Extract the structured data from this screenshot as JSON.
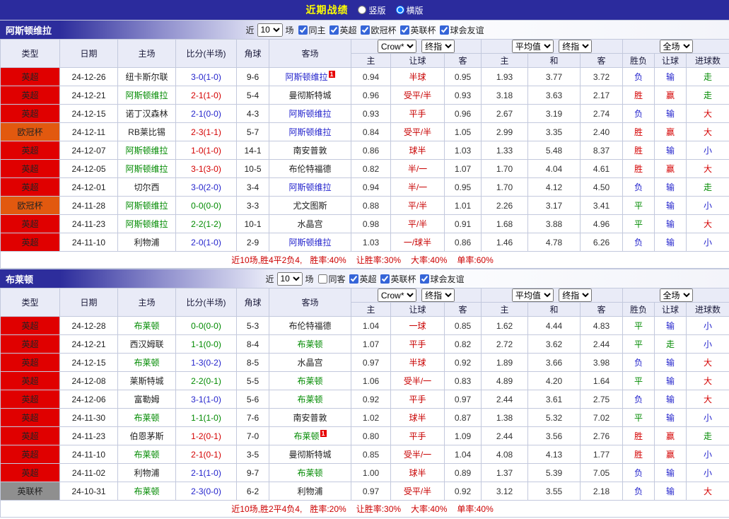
{
  "palette": {
    "red": "#d40000",
    "blue": "#2323cc",
    "green": "#008a00",
    "black": "#222222",
    "odds": "#333333",
    "handicap_red": "#c80000",
    "league_epl": "#e00000",
    "league_ucl": "#e2590f",
    "league_efl": "#8f8f8f",
    "topbar_bg": "#2b2b9d",
    "title_yellow": "#ffff00",
    "header_bg": "#e9ebf7",
    "summary_red": "#cc0000"
  },
  "top_bar": {
    "title": "近期战绩",
    "radio_vertical": "竖版",
    "radio_horizontal": "横版"
  },
  "sections": [
    {
      "team": "阿斯顿维拉",
      "controls": {
        "near_label": "近",
        "count": "10",
        "games_label": "场",
        "same": {
          "label": "同主",
          "checked": true
        },
        "filters": [
          {
            "label": "英超",
            "checked": true
          },
          {
            "label": "欧冠杯",
            "checked": true
          },
          {
            "label": "英联杯",
            "checked": true
          },
          {
            "label": "球会友谊",
            "checked": true
          }
        ]
      },
      "header": {
        "type": "类型",
        "date": "日期",
        "home": "主场",
        "score": "比分(半场)",
        "corner": "角球",
        "away": "客场",
        "asia_select1": "Crow*",
        "asia_select2": "终指",
        "asia_home": "主",
        "asia_handicap": "让球",
        "asia_away": "客",
        "euro_select1": "平均值",
        "euro_select2": "终指",
        "euro_home": "主",
        "euro_draw": "和",
        "euro_away": "客",
        "full_select": "全场",
        "result": "胜负",
        "handicap_result": "让球",
        "goals": "进球数"
      },
      "rows": [
        {
          "league": "英超",
          "league_key": "epl",
          "date": "24-12-26",
          "home": "纽卡斯尔联",
          "home_color": "black",
          "score": "3-0(1-0)",
          "score_color": "blue",
          "corner": "9-6",
          "away": "阿斯顿维拉",
          "away_color": "blue",
          "away_badge": "1",
          "asia": [
            "0.94",
            "半球",
            "0.95"
          ],
          "euro": [
            "1.93",
            "3.77",
            "3.72"
          ],
          "results": [
            "负",
            "输",
            "走"
          ],
          "result_colors": [
            "blue",
            "blue",
            "green"
          ]
        },
        {
          "league": "英超",
          "league_key": "epl",
          "date": "24-12-21",
          "home": "阿斯顿维拉",
          "home_color": "green",
          "score": "2-1(1-0)",
          "score_color": "red",
          "corner": "5-4",
          "away": "曼彻斯特城",
          "away_color": "black",
          "away_badge": "",
          "asia": [
            "0.96",
            "受平/半",
            "0.93"
          ],
          "euro": [
            "3.18",
            "3.63",
            "2.17"
          ],
          "results": [
            "胜",
            "赢",
            "走"
          ],
          "result_colors": [
            "red",
            "red",
            "green"
          ]
        },
        {
          "league": "英超",
          "league_key": "epl",
          "date": "24-12-15",
          "home": "诺丁汉森林",
          "home_color": "black",
          "score": "2-1(0-0)",
          "score_color": "blue",
          "corner": "4-3",
          "away": "阿斯顿维拉",
          "away_color": "blue",
          "away_badge": "",
          "asia": [
            "0.93",
            "平手",
            "0.96"
          ],
          "euro": [
            "2.67",
            "3.19",
            "2.74"
          ],
          "results": [
            "负",
            "输",
            "大"
          ],
          "result_colors": [
            "blue",
            "blue",
            "red"
          ]
        },
        {
          "league": "欧冠杯",
          "league_key": "ucl",
          "date": "24-12-11",
          "home": "RB莱比锡",
          "home_color": "black",
          "score": "2-3(1-1)",
          "score_color": "red",
          "corner": "5-7",
          "away": "阿斯顿维拉",
          "away_color": "blue",
          "away_badge": "",
          "asia": [
            "0.84",
            "受平/半",
            "1.05"
          ],
          "euro": [
            "2.99",
            "3.35",
            "2.40"
          ],
          "results": [
            "胜",
            "赢",
            "大"
          ],
          "result_colors": [
            "red",
            "red",
            "red"
          ]
        },
        {
          "league": "英超",
          "league_key": "epl",
          "date": "24-12-07",
          "home": "阿斯顿维拉",
          "home_color": "green",
          "score": "1-0(1-0)",
          "score_color": "red",
          "corner": "14-1",
          "away": "南安普敦",
          "away_color": "black",
          "away_badge": "",
          "asia": [
            "0.86",
            "球半",
            "1.03"
          ],
          "euro": [
            "1.33",
            "5.48",
            "8.37"
          ],
          "results": [
            "胜",
            "输",
            "小"
          ],
          "result_colors": [
            "red",
            "blue",
            "blue"
          ]
        },
        {
          "league": "英超",
          "league_key": "epl",
          "date": "24-12-05",
          "home": "阿斯顿维拉",
          "home_color": "green",
          "score": "3-1(3-0)",
          "score_color": "red",
          "corner": "10-5",
          "away": "布伦特福德",
          "away_color": "black",
          "away_badge": "",
          "asia": [
            "0.82",
            "半/一",
            "1.07"
          ],
          "euro": [
            "1.70",
            "4.04",
            "4.61"
          ],
          "results": [
            "胜",
            "赢",
            "大"
          ],
          "result_colors": [
            "red",
            "red",
            "red"
          ]
        },
        {
          "league": "英超",
          "league_key": "epl",
          "date": "24-12-01",
          "home": "切尔西",
          "home_color": "black",
          "score": "3-0(2-0)",
          "score_color": "blue",
          "corner": "3-4",
          "away": "阿斯顿维拉",
          "away_color": "blue",
          "away_badge": "",
          "asia": [
            "0.94",
            "半/一",
            "0.95"
          ],
          "euro": [
            "1.70",
            "4.12",
            "4.50"
          ],
          "results": [
            "负",
            "输",
            "走"
          ],
          "result_colors": [
            "blue",
            "blue",
            "green"
          ]
        },
        {
          "league": "欧冠杯",
          "league_key": "ucl",
          "date": "24-11-28",
          "home": "阿斯顿维拉",
          "home_color": "green",
          "score": "0-0(0-0)",
          "score_color": "green",
          "corner": "3-3",
          "away": "尤文图斯",
          "away_color": "black",
          "away_badge": "",
          "asia": [
            "0.88",
            "平/半",
            "1.01"
          ],
          "euro": [
            "2.26",
            "3.17",
            "3.41"
          ],
          "results": [
            "平",
            "输",
            "小"
          ],
          "result_colors": [
            "green",
            "blue",
            "blue"
          ]
        },
        {
          "league": "英超",
          "league_key": "epl",
          "date": "24-11-23",
          "home": "阿斯顿维拉",
          "home_color": "green",
          "score": "2-2(1-2)",
          "score_color": "green",
          "corner": "10-1",
          "away": "水晶宫",
          "away_color": "black",
          "away_badge": "",
          "asia": [
            "0.98",
            "平/半",
            "0.91"
          ],
          "euro": [
            "1.68",
            "3.88",
            "4.96"
          ],
          "results": [
            "平",
            "输",
            "大"
          ],
          "result_colors": [
            "green",
            "blue",
            "red"
          ]
        },
        {
          "league": "英超",
          "league_key": "epl",
          "date": "24-11-10",
          "home": "利物浦",
          "home_color": "black",
          "score": "2-0(1-0)",
          "score_color": "blue",
          "corner": "2-9",
          "away": "阿斯顿维拉",
          "away_color": "blue",
          "away_badge": "",
          "asia": [
            "1.03",
            "一/球半",
            "0.86"
          ],
          "euro": [
            "1.46",
            "4.78",
            "6.26"
          ],
          "results": [
            "负",
            "输",
            "小"
          ],
          "result_colors": [
            "blue",
            "blue",
            "blue"
          ]
        }
      ],
      "summary": {
        "prefix": "近10场,胜4平2负4,",
        "rates": [
          "胜率:40%",
          "让胜率:30%",
          "大率:40%",
          "单率:60%"
        ]
      }
    },
    {
      "team": "布莱顿",
      "controls": {
        "near_label": "近",
        "count": "10",
        "games_label": "场",
        "same": {
          "label": "同客",
          "checked": false
        },
        "filters": [
          {
            "label": "英超",
            "checked": true
          },
          {
            "label": "英联杯",
            "checked": true
          },
          {
            "label": "球会友谊",
            "checked": true
          }
        ]
      },
      "header": {
        "type": "类型",
        "date": "日期",
        "home": "主场",
        "score": "比分(半场)",
        "corner": "角球",
        "away": "客场",
        "asia_select1": "Crow*",
        "asia_select2": "终指",
        "asia_home": "主",
        "asia_handicap": "让球",
        "asia_away": "客",
        "euro_select1": "平均值",
        "euro_select2": "终指",
        "euro_home": "主",
        "euro_draw": "和",
        "euro_away": "客",
        "full_select": "全场",
        "result": "胜负",
        "handicap_result": "让球",
        "goals": "进球数"
      },
      "rows": [
        {
          "league": "英超",
          "league_key": "epl",
          "date": "24-12-28",
          "home": "布莱顿",
          "home_color": "green",
          "score": "0-0(0-0)",
          "score_color": "green",
          "corner": "5-3",
          "away": "布伦特福德",
          "away_color": "black",
          "away_badge": "",
          "asia": [
            "1.04",
            "一球",
            "0.85"
          ],
          "euro": [
            "1.62",
            "4.44",
            "4.83"
          ],
          "results": [
            "平",
            "输",
            "小"
          ],
          "result_colors": [
            "green",
            "blue",
            "blue"
          ]
        },
        {
          "league": "英超",
          "league_key": "epl",
          "date": "24-12-21",
          "home": "西汉姆联",
          "home_color": "black",
          "score": "1-1(0-0)",
          "score_color": "green",
          "corner": "8-4",
          "away": "布莱顿",
          "away_color": "green",
          "away_badge": "",
          "asia": [
            "1.07",
            "平手",
            "0.82"
          ],
          "euro": [
            "2.72",
            "3.62",
            "2.44"
          ],
          "results": [
            "平",
            "走",
            "小"
          ],
          "result_colors": [
            "green",
            "green",
            "blue"
          ]
        },
        {
          "league": "英超",
          "league_key": "epl",
          "date": "24-12-15",
          "home": "布莱顿",
          "home_color": "green",
          "score": "1-3(0-2)",
          "score_color": "blue",
          "corner": "8-5",
          "away": "水晶宫",
          "away_color": "black",
          "away_badge": "",
          "asia": [
            "0.97",
            "半球",
            "0.92"
          ],
          "euro": [
            "1.89",
            "3.66",
            "3.98"
          ],
          "results": [
            "负",
            "输",
            "大"
          ],
          "result_colors": [
            "blue",
            "blue",
            "red"
          ]
        },
        {
          "league": "英超",
          "league_key": "epl",
          "date": "24-12-08",
          "home": "莱斯特城",
          "home_color": "black",
          "score": "2-2(0-1)",
          "score_color": "green",
          "corner": "5-5",
          "away": "布莱顿",
          "away_color": "green",
          "away_badge": "",
          "asia": [
            "1.06",
            "受半/一",
            "0.83"
          ],
          "euro": [
            "4.89",
            "4.20",
            "1.64"
          ],
          "results": [
            "平",
            "输",
            "大"
          ],
          "result_colors": [
            "green",
            "blue",
            "red"
          ]
        },
        {
          "league": "英超",
          "league_key": "epl",
          "date": "24-12-06",
          "home": "富勒姆",
          "home_color": "black",
          "score": "3-1(1-0)",
          "score_color": "blue",
          "corner": "5-6",
          "away": "布莱顿",
          "away_color": "green",
          "away_badge": "",
          "asia": [
            "0.92",
            "平手",
            "0.97"
          ],
          "euro": [
            "2.44",
            "3.61",
            "2.75"
          ],
          "results": [
            "负",
            "输",
            "大"
          ],
          "result_colors": [
            "blue",
            "blue",
            "red"
          ]
        },
        {
          "league": "英超",
          "league_key": "epl",
          "date": "24-11-30",
          "home": "布莱顿",
          "home_color": "green",
          "score": "1-1(1-0)",
          "score_color": "green",
          "corner": "7-6",
          "away": "南安普敦",
          "away_color": "black",
          "away_badge": "",
          "asia": [
            "1.02",
            "球半",
            "0.87"
          ],
          "euro": [
            "1.38",
            "5.32",
            "7.02"
          ],
          "results": [
            "平",
            "输",
            "小"
          ],
          "result_colors": [
            "green",
            "blue",
            "blue"
          ]
        },
        {
          "league": "英超",
          "league_key": "epl",
          "date": "24-11-23",
          "home": "伯恩茅斯",
          "home_color": "black",
          "score": "1-2(0-1)",
          "score_color": "red",
          "corner": "7-0",
          "away": "布莱顿",
          "away_color": "green",
          "away_badge": "1",
          "asia": [
            "0.80",
            "平手",
            "1.09"
          ],
          "euro": [
            "2.44",
            "3.56",
            "2.76"
          ],
          "results": [
            "胜",
            "赢",
            "走"
          ],
          "result_colors": [
            "red",
            "red",
            "green"
          ]
        },
        {
          "league": "英超",
          "league_key": "epl",
          "date": "24-11-10",
          "home": "布莱顿",
          "home_color": "green",
          "score": "2-1(0-1)",
          "score_color": "red",
          "corner": "3-5",
          "away": "曼彻斯特城",
          "away_color": "black",
          "away_badge": "",
          "asia": [
            "0.85",
            "受半/一",
            "1.04"
          ],
          "euro": [
            "4.08",
            "4.13",
            "1.77"
          ],
          "results": [
            "胜",
            "赢",
            "小"
          ],
          "result_colors": [
            "red",
            "red",
            "blue"
          ]
        },
        {
          "league": "英超",
          "league_key": "epl",
          "date": "24-11-02",
          "home": "利物浦",
          "home_color": "black",
          "score": "2-1(1-0)",
          "score_color": "blue",
          "corner": "9-7",
          "away": "布莱顿",
          "away_color": "green",
          "away_badge": "",
          "asia": [
            "1.00",
            "球半",
            "0.89"
          ],
          "euro": [
            "1.37",
            "5.39",
            "7.05"
          ],
          "results": [
            "负",
            "输",
            "小"
          ],
          "result_colors": [
            "blue",
            "blue",
            "blue"
          ]
        },
        {
          "league": "英联杯",
          "league_key": "efl",
          "date": "24-10-31",
          "home": "布莱顿",
          "home_color": "green",
          "score": "2-3(0-0)",
          "score_color": "blue",
          "corner": "6-2",
          "away": "利物浦",
          "away_color": "black",
          "away_badge": "",
          "asia": [
            "0.97",
            "受平/半",
            "0.92"
          ],
          "euro": [
            "3.12",
            "3.55",
            "2.18"
          ],
          "results": [
            "负",
            "输",
            "大"
          ],
          "result_colors": [
            "blue",
            "blue",
            "red"
          ]
        }
      ],
      "summary": {
        "prefix": "近10场,胜2平4负4,",
        "rates": [
          "胜率:20%",
          "让胜率:30%",
          "大率:40%",
          "单率:40%"
        ]
      }
    }
  ]
}
